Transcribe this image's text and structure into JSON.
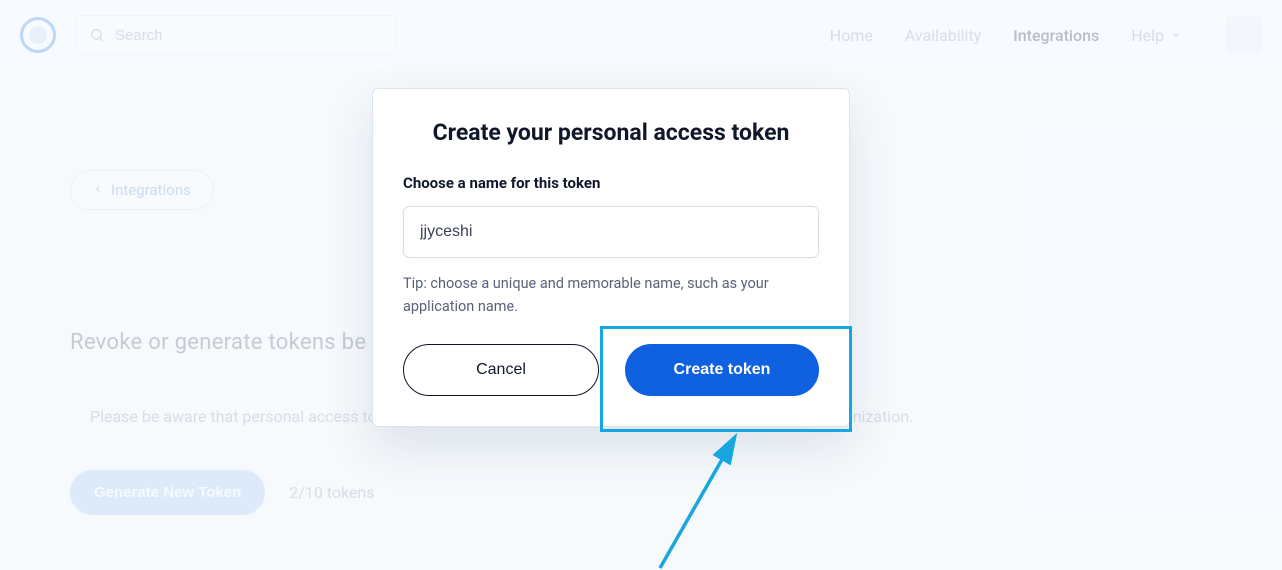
{
  "header": {
    "search_placeholder": "Search",
    "nav": {
      "home": "Home",
      "availability": "Availability",
      "integrations": "Integrations",
      "help": "Help"
    }
  },
  "page": {
    "back_label": "Integrations",
    "section_heading": "Revoke or generate tokens be",
    "warning_line": "Please be aware that personal access tokens can be used to access Calendly data for everyone in your organization.",
    "generate_button": "Generate New Token",
    "token_count": "2/10 tokens"
  },
  "modal": {
    "title": "Create your personal access token",
    "field_label": "Choose a name for this token",
    "token_name_value": "jjyceshi",
    "tip": "Tip: choose a unique and memorable name, such as your application name.",
    "cancel": "Cancel",
    "create": "Create token"
  },
  "colors": {
    "primary": "#1061e0",
    "highlight": "#17a7e0"
  }
}
